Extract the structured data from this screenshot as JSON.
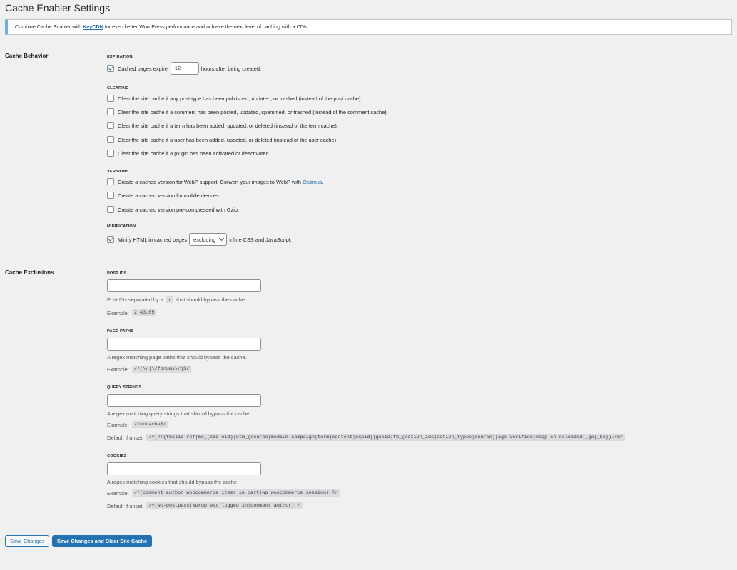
{
  "page": {
    "title": "Cache Enabler Settings"
  },
  "notice": {
    "prefix": "Combine Cache Enabler with ",
    "link": "KeyCDN",
    "suffix": " for even better WordPress performance and achieve the next level of caching with a CDN."
  },
  "cache_behavior": {
    "label": "Cache Behavior",
    "expiration": {
      "heading": "EXPIRATION",
      "checked": true,
      "before": "Cached pages expire",
      "hours": "12",
      "after": "hours after being created."
    },
    "clearing": {
      "heading": "CLEARING",
      "items": [
        {
          "label": "Clear the site cache if any post type has been published, updated, or trashed (instead of the post cache).",
          "checked": false
        },
        {
          "label": "Clear the site cache if a comment has been posted, updated, spammed, or trashed (instead of the comment cache).",
          "checked": false
        },
        {
          "label": "Clear the site cache if a term has been added, updated, or deleted (instead of the term cache).",
          "checked": false
        },
        {
          "label": "Clear the site cache if a user has been added, updated, or deleted (instead of the user cache).",
          "checked": false
        },
        {
          "label": "Clear the site cache if a plugin has been activated or deactivated.",
          "checked": false
        }
      ]
    },
    "versions": {
      "heading": "VERSIONS",
      "webp_text": "Create a cached version for WebP support. Convert your images to WebP with ",
      "webp_link": "Optimus",
      "webp_end": ".",
      "mobile": "Create a cached version for mobile devices.",
      "gzip": "Create a cached version pre-compressed with Gzip."
    },
    "minification": {
      "heading": "MINIFICATION",
      "checked": true,
      "before": "Minify HTML in cached pages",
      "select_value": "excluding",
      "after": "inline CSS and JavaScript."
    }
  },
  "cache_exclusions": {
    "label": "Cache Exclusions",
    "post_ids": {
      "heading": "POST IDS",
      "desc_before": "Post IDs separated by a",
      "sep": ",",
      "desc_after": "that should bypass the cache.",
      "example_label": "Example:",
      "example": "2,43,65"
    },
    "page_paths": {
      "heading": "PAGE PATHS",
      "desc": "A regex matching page paths that should bypass the cache.",
      "example_label": "Example:",
      "example": "/^(\\/|\\/forums\\/)$/"
    },
    "query_strings": {
      "heading": "QUERY STRINGS",
      "desc": "A regex matching query strings that should bypass the cache.",
      "example_label": "Example:",
      "example": "/^nocache$/",
      "default_label": "Default if unset:",
      "default": "/^(?!(fbclid|ref|mc_(cid|eid)|utm_(source|medium|campaign|term|content|expid)|gclid|fb_(action_ids|action_types|source)|age-verified|usqp|cn-reloaded|_ga|_ke)).+$/"
    },
    "cookies": {
      "heading": "COOKIES",
      "desc": "A regex matching cookies that should bypass the cache.",
      "example_label": "Example:",
      "example": "/^(comment_author|woocommerce_items_in_cart|wp_woocommerce_session)_?/",
      "default_label": "Default if unset:",
      "default": "/^(wp-postpass|wordpress_logged_in|comment_author)_/"
    }
  },
  "buttons": {
    "save": "Save Changes",
    "save_clear": "Save Changes and Clear Site Cache"
  },
  "colors": {
    "accent": "#2271b1",
    "background": "#f0f0f1",
    "notice_border": "#72aee6"
  }
}
